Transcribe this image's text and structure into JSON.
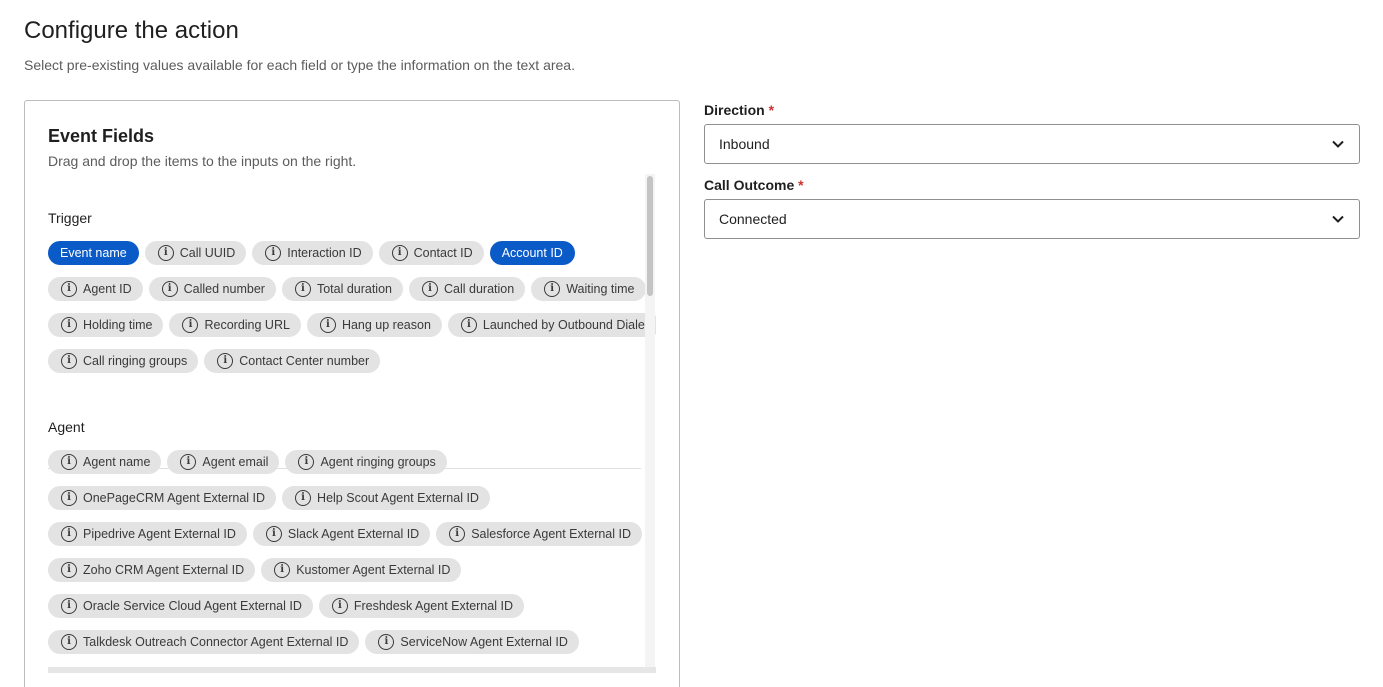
{
  "header": {
    "title": "Configure the action",
    "subtitle": "Select pre-existing values available for each field or type the information on the text area."
  },
  "event_fields": {
    "title": "Event Fields",
    "subtitle": "Drag and drop the items to the inputs on the right.",
    "sections": [
      {
        "title": "Trigger",
        "rows": [
          [
            {
              "label": "Event name",
              "selected": true
            },
            {
              "label": "Call UUID",
              "selected": false
            },
            {
              "label": "Interaction ID",
              "selected": false
            },
            {
              "label": "Contact ID",
              "selected": false
            },
            {
              "label": "Account ID",
              "selected": true
            }
          ],
          [
            {
              "label": "Agent ID",
              "selected": false
            },
            {
              "label": "Called number",
              "selected": false
            },
            {
              "label": "Total duration",
              "selected": false
            },
            {
              "label": "Call duration",
              "selected": false
            },
            {
              "label": "Waiting time",
              "selected": false
            }
          ],
          [
            {
              "label": "Holding time",
              "selected": false
            },
            {
              "label": "Recording URL",
              "selected": false
            },
            {
              "label": "Hang up reason",
              "selected": false
            },
            {
              "label": "Launched by Outbound Dialer",
              "selected": false
            }
          ],
          [
            {
              "label": "Call ringing groups",
              "selected": false
            },
            {
              "label": "Contact Center number",
              "selected": false
            }
          ]
        ]
      },
      {
        "title": "Agent",
        "rows": [
          [
            {
              "label": "Agent name",
              "selected": false
            },
            {
              "label": "Agent email",
              "selected": false
            },
            {
              "label": "Agent ringing groups",
              "selected": false
            }
          ],
          [
            {
              "label": "OnePageCRM Agent External ID",
              "selected": false
            },
            {
              "label": "Help Scout Agent External ID",
              "selected": false
            }
          ],
          [
            {
              "label": "Pipedrive Agent External ID",
              "selected": false
            },
            {
              "label": "Slack Agent External ID",
              "selected": false
            },
            {
              "label": "Salesforce Agent External ID",
              "selected": false
            }
          ],
          [
            {
              "label": "Zoho CRM Agent External ID",
              "selected": false
            },
            {
              "label": "Kustomer Agent External ID",
              "selected": false
            }
          ],
          [
            {
              "label": "Oracle Service Cloud Agent External ID",
              "selected": false
            },
            {
              "label": "Freshdesk Agent External ID",
              "selected": false
            }
          ],
          [
            {
              "label": "Talkdesk Outreach Connector Agent External ID",
              "selected": false
            },
            {
              "label": "ServiceNow Agent External ID",
              "selected": false
            }
          ]
        ]
      }
    ]
  },
  "form": {
    "direction": {
      "label": "Direction",
      "required_mark": "*",
      "value": "Inbound"
    },
    "call_outcome": {
      "label": "Call Outcome",
      "required_mark": "*",
      "value": "Connected"
    }
  },
  "icons": {
    "chip_icon": "info-icon",
    "select_icon": "chevron-down-icon"
  },
  "colors": {
    "selected_chip": "#0a5ac8",
    "chip": "#e3e3e3",
    "required": "#d32f2f"
  }
}
